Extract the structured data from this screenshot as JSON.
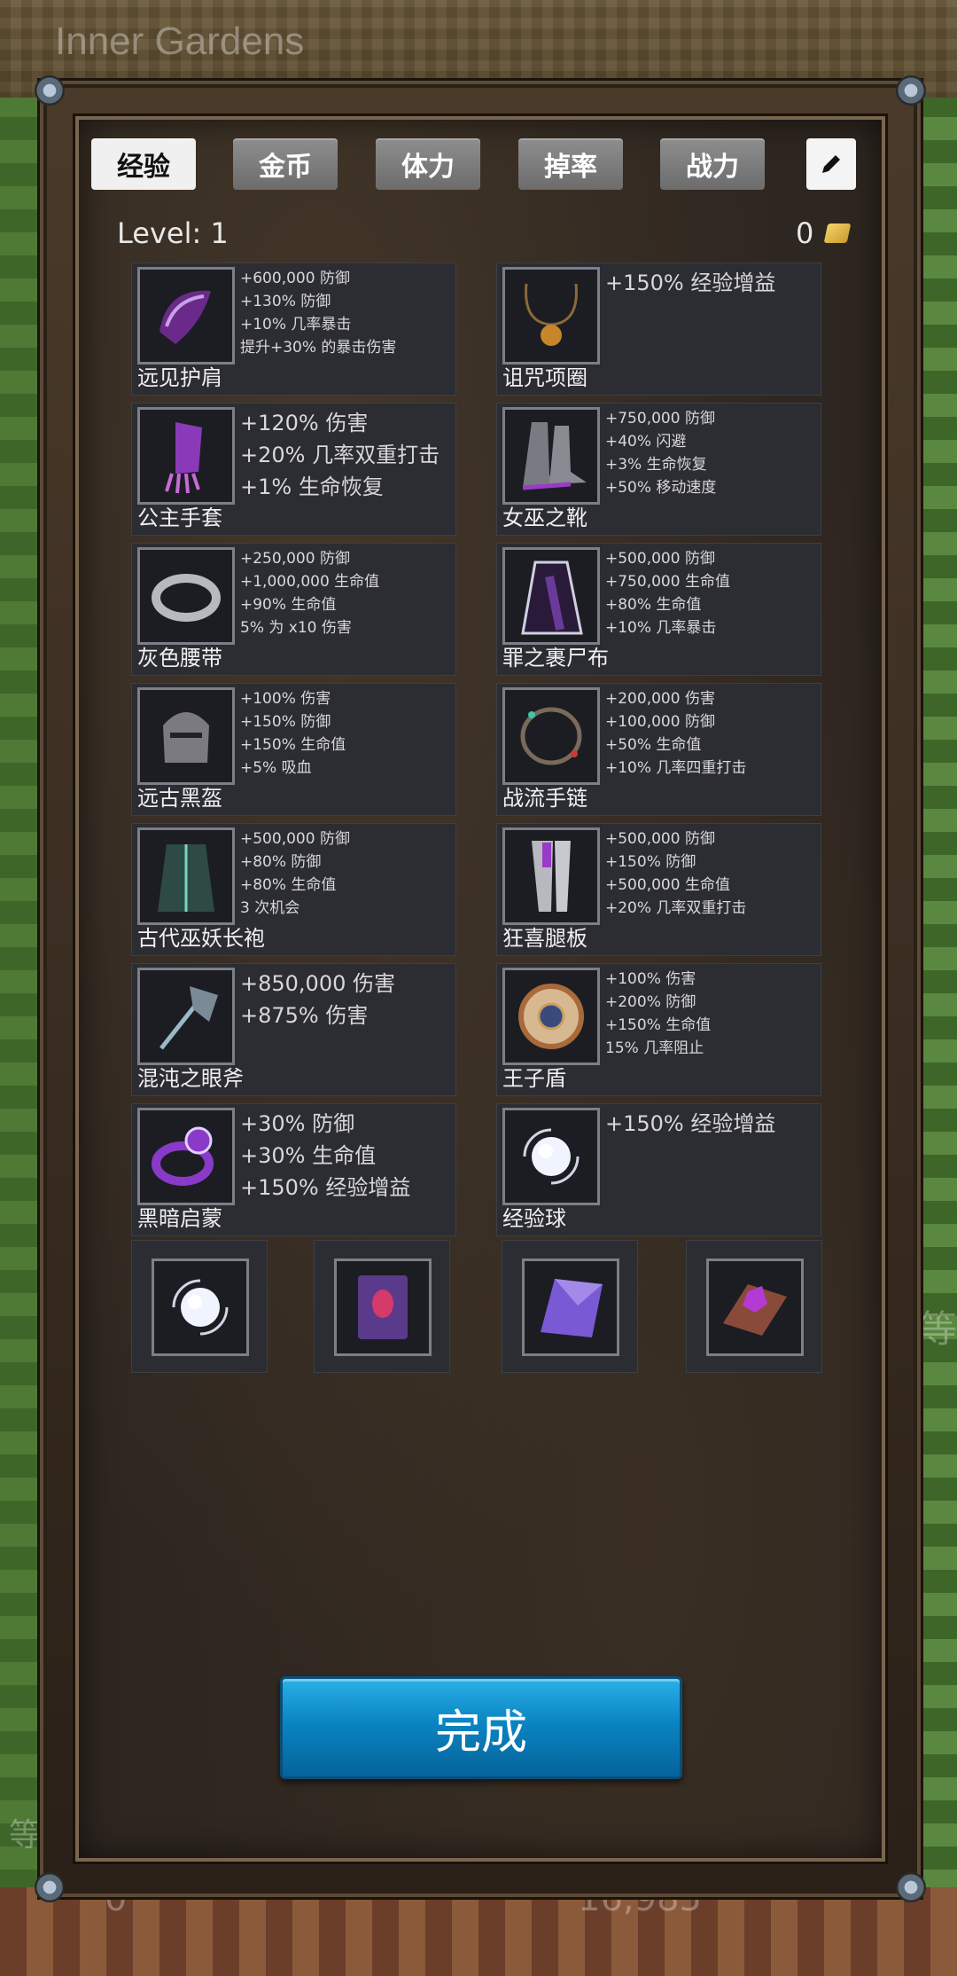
{
  "background": {
    "area_title": "Inner Gardens",
    "bottom_left_value": "0",
    "bottom_right_value": "16,985",
    "side_text": "等",
    "side_text_left": "等"
  },
  "tabs": [
    "经验",
    "金币",
    "体力",
    "掉率",
    "战力"
  ],
  "active_tab": "经验",
  "level_label": "Level:  1",
  "coins": "0",
  "items_left": [
    {
      "name": "远见护肩",
      "icon": "purple-pauldron-icon",
      "size": "small",
      "stats": [
        "+600,000 防御",
        "+130% 防御",
        "+10% 几率暴击",
        "提升+30% 的暴击伤害"
      ]
    },
    {
      "name": "公主手套",
      "icon": "purple-gauntlet-icon",
      "size": "big",
      "stats": [
        "+120% 伤害",
        "+20% 几率双重打击",
        "+1% 生命恢复"
      ]
    },
    {
      "name": "灰色腰带",
      "icon": "grey-belt-icon",
      "size": "small",
      "stats": [
        "+250,000 防御",
        "+1,000,000 生命值",
        "+90% 生命值",
        "5% 为 x10 伤害"
      ]
    },
    {
      "name": "远古黑盔",
      "icon": "black-helmet-icon",
      "size": "small",
      "stats": [
        "+100% 伤害",
        "+150% 防御",
        "+150% 生命值",
        "+5% 吸血"
      ]
    },
    {
      "name": "古代巫妖长袍",
      "icon": "lich-robe-icon",
      "size": "small",
      "stats": [
        "+500,000 防御",
        "+80% 防御",
        "+80% 生命值",
        "3 次机会"
      ]
    },
    {
      "name": "混沌之眼斧",
      "icon": "chaos-axe-icon",
      "size": "big",
      "stats": [
        "+850,000 伤害",
        "+875% 伤害"
      ]
    },
    {
      "name": "黑暗启蒙",
      "icon": "purple-ring-icon",
      "size": "big",
      "stats": [
        "+30% 防御",
        "+30% 生命值",
        "+150% 经验增益"
      ]
    }
  ],
  "items_right": [
    {
      "name": "诅咒项圈",
      "icon": "cursed-necklace-icon",
      "size": "big",
      "stats": [
        "+150% 经验增益"
      ]
    },
    {
      "name": "女巫之靴",
      "icon": "witch-boots-icon",
      "size": "small",
      "stats": [
        "+750,000 防御",
        "+40% 闪避",
        "+3% 生命恢复",
        "+50% 移动速度"
      ]
    },
    {
      "name": "罪之裹尸布",
      "icon": "shroud-cloak-icon",
      "size": "small",
      "stats": [
        "+500,000 防御",
        "+750,000 生命值",
        "+80% 生命值",
        "+10% 几率暴击"
      ]
    },
    {
      "name": "战流手链",
      "icon": "bracelet-icon",
      "size": "small",
      "stats": [
        "+200,000 伤害",
        "+100,000 防御",
        "+50% 生命值",
        "+10% 几率四重打击"
      ]
    },
    {
      "name": "狂喜腿板",
      "icon": "leg-plates-icon",
      "size": "small",
      "stats": [
        "+500,000 防御",
        "+150% 防御",
        "+500,000 生命值",
        "+20% 几率双重打击"
      ]
    },
    {
      "name": "王子盾",
      "icon": "round-shield-icon",
      "size": "small",
      "stats": [
        "+100% 伤害",
        "+200% 防御",
        "+150% 生命值",
        "15% 几率阻止"
      ]
    },
    {
      "name": "经验球",
      "icon": "exp-orb-icon",
      "size": "big",
      "stats": [
        "+150% 经验增益"
      ]
    }
  ],
  "bottom_slots": [
    "exp-orb-icon",
    "red-gem-tome-icon",
    "purple-crystal-shard-icon",
    "gem-book-icon"
  ],
  "done_button": "完成"
}
